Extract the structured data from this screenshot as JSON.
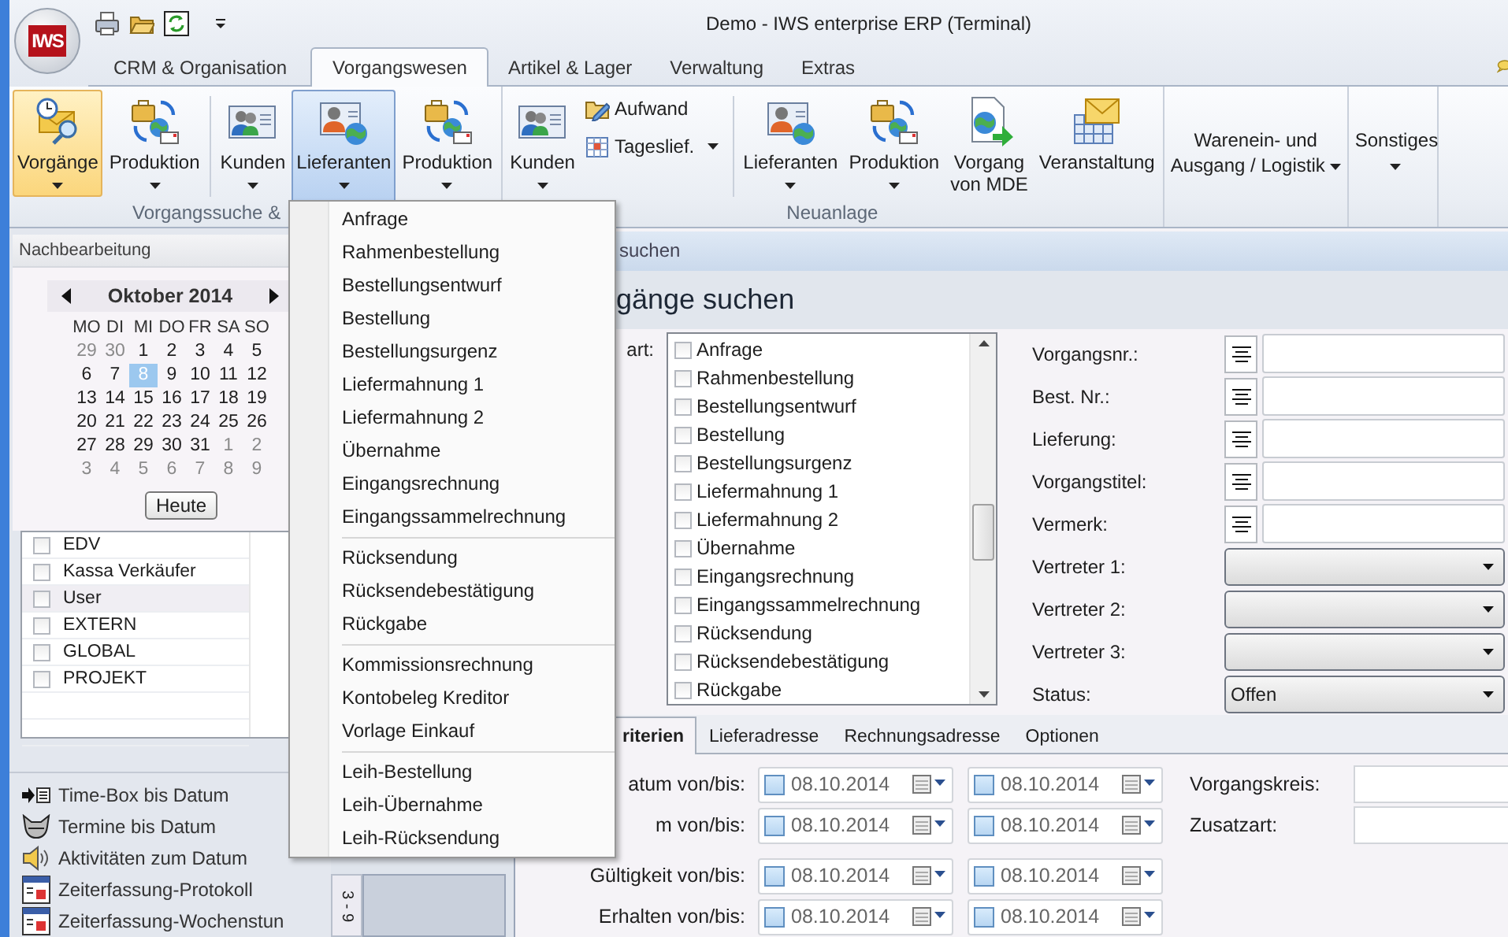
{
  "window": {
    "logo": "IWS",
    "title": "Demo - IWS enterprise ERP (Terminal)"
  },
  "ribbon_tabs": [
    {
      "label": "CRM & Organisation",
      "selected": false
    },
    {
      "label": "Vorgangswesen",
      "selected": true
    },
    {
      "label": "Artikel & Lager",
      "selected": false
    },
    {
      "label": "Verwaltung",
      "selected": false
    },
    {
      "label": "Extras",
      "selected": false
    }
  ],
  "ribbon_groups": [
    {
      "label": "Vorgangssuche &",
      "items": [
        {
          "kind": "large",
          "label": "Vorgänge",
          "dropdown": true,
          "selected": true,
          "expanded": false
        },
        {
          "kind": "large",
          "label": "Produktion",
          "dropdown": true,
          "selected": false,
          "expanded": false
        },
        {
          "kind": "separator"
        },
        {
          "kind": "large",
          "label": "Kunden",
          "dropdown": true,
          "selected": false,
          "expanded": false
        },
        {
          "kind": "large",
          "label": "Lieferanten",
          "dropdown": true,
          "selected": false,
          "expanded": true
        },
        {
          "kind": "large",
          "label": "Produktion",
          "dropdown": true,
          "selected": false,
          "expanded": false
        }
      ]
    },
    {
      "label": "Neuanlage",
      "items": [
        {
          "kind": "large",
          "label": "Kunden",
          "dropdown": true,
          "selected": false,
          "expanded": false
        },
        {
          "kind": "stack",
          "buttons": [
            {
              "label": "Aufwand",
              "dropdown": false
            },
            {
              "label": "Tageslief.",
              "dropdown": true
            }
          ]
        },
        {
          "kind": "separator"
        },
        {
          "kind": "large",
          "label": "Lieferanten",
          "dropdown": true,
          "selected": false,
          "expanded": false
        },
        {
          "kind": "large",
          "label": "Produktion",
          "dropdown": true,
          "selected": false,
          "expanded": false
        },
        {
          "kind": "large",
          "label": "Vorgang\nvon MDE",
          "dropdown": false,
          "selected": false,
          "expanded": false
        },
        {
          "kind": "large",
          "label": "Veranstaltung",
          "dropdown": false,
          "selected": false,
          "expanded": false
        }
      ]
    },
    {
      "items": [
        {
          "kind": "text",
          "label": "Warenein- und\nAusgang / Logistik",
          "dropdown": true
        }
      ]
    },
    {
      "items": [
        {
          "kind": "text",
          "label": "Sonstiges",
          "dropdown": true
        }
      ]
    }
  ],
  "dropdown_menu": {
    "sections": [
      {
        "items": [
          "Anfrage",
          "Rahmenbestellung",
          "Bestellungsentwurf",
          "Bestellung",
          "Bestellungsurgenz",
          "Liefermahnung 1",
          "Liefermahnung 2",
          "Übernahme",
          "Eingangsrechnung",
          "Eingangssammelrechnung"
        ]
      },
      {
        "items": [
          "Rücksendung",
          "Rücksendebestätigung",
          "Rückgabe"
        ]
      },
      {
        "items": [
          "Kommissionsrechnung",
          "Kontobeleg Kreditor",
          "Vorlage Einkauf"
        ]
      },
      {
        "items": [
          "Leih-Bestellung",
          "Leih-Übernahme",
          "Leih-Rücksendung"
        ]
      }
    ]
  },
  "sidebar": {
    "title": "Nachbearbeitung",
    "calendar": {
      "month": "Oktober 2014",
      "weekdays": [
        "MO",
        "DI",
        "MI",
        "DO",
        "FR",
        "SA",
        "SO"
      ],
      "weeks": [
        [
          {
            "day": "29",
            "other_month": true,
            "selected": false
          },
          {
            "day": "30",
            "other_month": true,
            "selected": false
          },
          {
            "day": "1",
            "other_month": false,
            "selected": false
          },
          {
            "day": "2",
            "other_month": false,
            "selected": false
          },
          {
            "day": "3",
            "other_month": false,
            "selected": false
          },
          {
            "day": "4",
            "other_month": false,
            "selected": false
          },
          {
            "day": "5",
            "other_month": false,
            "selected": false
          }
        ],
        [
          {
            "day": "6",
            "other_month": false,
            "selected": false
          },
          {
            "day": "7",
            "other_month": false,
            "selected": false
          },
          {
            "day": "8",
            "other_month": false,
            "selected": true
          },
          {
            "day": "9",
            "other_month": false,
            "selected": false
          },
          {
            "day": "10",
            "other_month": false,
            "selected": false
          },
          {
            "day": "11",
            "other_month": false,
            "selected": false
          },
          {
            "day": "12",
            "other_month": false,
            "selected": false
          }
        ],
        [
          {
            "day": "13",
            "other_month": false,
            "selected": false
          },
          {
            "day": "14",
            "other_month": false,
            "selected": false
          },
          {
            "day": "15",
            "other_month": false,
            "selected": false
          },
          {
            "day": "16",
            "other_month": false,
            "selected": false
          },
          {
            "day": "17",
            "other_month": false,
            "selected": false
          },
          {
            "day": "18",
            "other_month": false,
            "selected": false
          },
          {
            "day": "19",
            "other_month": false,
            "selected": false
          }
        ],
        [
          {
            "day": "20",
            "other_month": false,
            "selected": false
          },
          {
            "day": "21",
            "other_month": false,
            "selected": false
          },
          {
            "day": "22",
            "other_month": false,
            "selected": false
          },
          {
            "day": "23",
            "other_month": false,
            "selected": false
          },
          {
            "day": "24",
            "other_month": false,
            "selected": false
          },
          {
            "day": "25",
            "other_month": false,
            "selected": false
          },
          {
            "day": "26",
            "other_month": false,
            "selected": false
          }
        ],
        [
          {
            "day": "27",
            "other_month": false,
            "selected": false
          },
          {
            "day": "28",
            "other_month": false,
            "selected": false
          },
          {
            "day": "29",
            "other_month": false,
            "selected": false
          },
          {
            "day": "30",
            "other_month": false,
            "selected": false
          },
          {
            "day": "31",
            "other_month": false,
            "selected": false
          },
          {
            "day": "1",
            "other_month": true,
            "selected": false
          },
          {
            "day": "2",
            "other_month": true,
            "selected": false
          }
        ],
        [
          {
            "day": "3",
            "other_month": true,
            "selected": false
          },
          {
            "day": "4",
            "other_month": true,
            "selected": false
          },
          {
            "day": "5",
            "other_month": true,
            "selected": false
          },
          {
            "day": "6",
            "other_month": true,
            "selected": false
          },
          {
            "day": "7",
            "other_month": true,
            "selected": false
          },
          {
            "day": "8",
            "other_month": true,
            "selected": false
          },
          {
            "day": "9",
            "other_month": true,
            "selected": false
          }
        ]
      ],
      "today_button": "Heute"
    },
    "groups": [
      {
        "label": "EDV",
        "checked": false,
        "selected": false
      },
      {
        "label": "Kassa Verkäufer",
        "checked": false,
        "selected": false
      },
      {
        "label": "User",
        "checked": false,
        "selected": true
      },
      {
        "label": "EXTERN",
        "checked": false,
        "selected": false
      },
      {
        "label": "GLOBAL",
        "checked": false,
        "selected": false
      },
      {
        "label": "PROJEKT",
        "checked": false,
        "selected": false
      }
    ],
    "links": [
      "Time-Box bis Datum",
      "Termine bis Datum",
      "Aktivitäten zum Datum",
      "Zeiterfassung-Protokoll",
      "Zeiterfassung-Wochenstun"
    ]
  },
  "side_tab": "3 - 9",
  "search_panel": {
    "header": "suchen",
    "title": "gänge suchen",
    "type_label": "art:",
    "types": [
      {
        "label": "Anfrage",
        "checked": false
      },
      {
        "label": "Rahmenbestellung",
        "checked": false
      },
      {
        "label": "Bestellungsentwurf",
        "checked": false
      },
      {
        "label": "Bestellung",
        "checked": false
      },
      {
        "label": "Bestellungsurgenz",
        "checked": false
      },
      {
        "label": "Liefermahnung 1",
        "checked": false
      },
      {
        "label": "Liefermahnung 2",
        "checked": false
      },
      {
        "label": "Übernahme",
        "checked": false
      },
      {
        "label": "Eingangsrechnung",
        "checked": false
      },
      {
        "label": "Eingangssammelrechnung",
        "checked": false
      },
      {
        "label": "Rücksendung",
        "checked": false
      },
      {
        "label": "Rücksendebestätigung",
        "checked": false
      },
      {
        "label": "Rückgabe",
        "checked": false
      }
    ],
    "fields": [
      {
        "kind": "text",
        "label": "Vorgangsnr.:"
      },
      {
        "kind": "text",
        "label": "Best. Nr.:"
      },
      {
        "kind": "text",
        "label": "Lieferung:"
      },
      {
        "kind": "text",
        "label": "Vorgangstitel:"
      },
      {
        "kind": "text",
        "label": "Vermerk:"
      },
      {
        "kind": "combo",
        "label": "Vertreter 1:"
      },
      {
        "kind": "combo",
        "label": "Vertreter 2:"
      },
      {
        "kind": "combo",
        "label": "Vertreter 3:"
      },
      {
        "kind": "combo",
        "label": "Status:",
        "value": "Offen"
      }
    ],
    "criteria_tabs": [
      {
        "label": "riterien",
        "selected": true
      },
      {
        "label": "Lieferadresse",
        "selected": false
      },
      {
        "label": "Rechnungsadresse",
        "selected": false
      },
      {
        "label": "Optionen",
        "selected": false
      }
    ],
    "date_rows": [
      {
        "label": "atum von/bis:",
        "from": {
          "checked": false,
          "value": "08.10.2014"
        },
        "to": {
          "checked": false,
          "value": "08.10.2014"
        }
      },
      {
        "label": "m von/bis:",
        "from": {
          "checked": false,
          "value": "08.10.2014"
        },
        "to": {
          "checked": false,
          "value": "08.10.2014"
        }
      },
      {
        "label": "Gültigkeit von/bis:",
        "from": {
          "checked": false,
          "value": "08.10.2014"
        },
        "to": {
          "checked": false,
          "value": "08.10.2014"
        }
      },
      {
        "label": "Erhalten von/bis:",
        "from": {
          "checked": false,
          "value": "08.10.2014"
        },
        "to": {
          "checked": false,
          "value": "08.10.2014"
        }
      }
    ],
    "extra_fields": [
      {
        "label": "Vorgangskreis:"
      },
      {
        "label": "Zusatzart:"
      }
    ]
  }
}
